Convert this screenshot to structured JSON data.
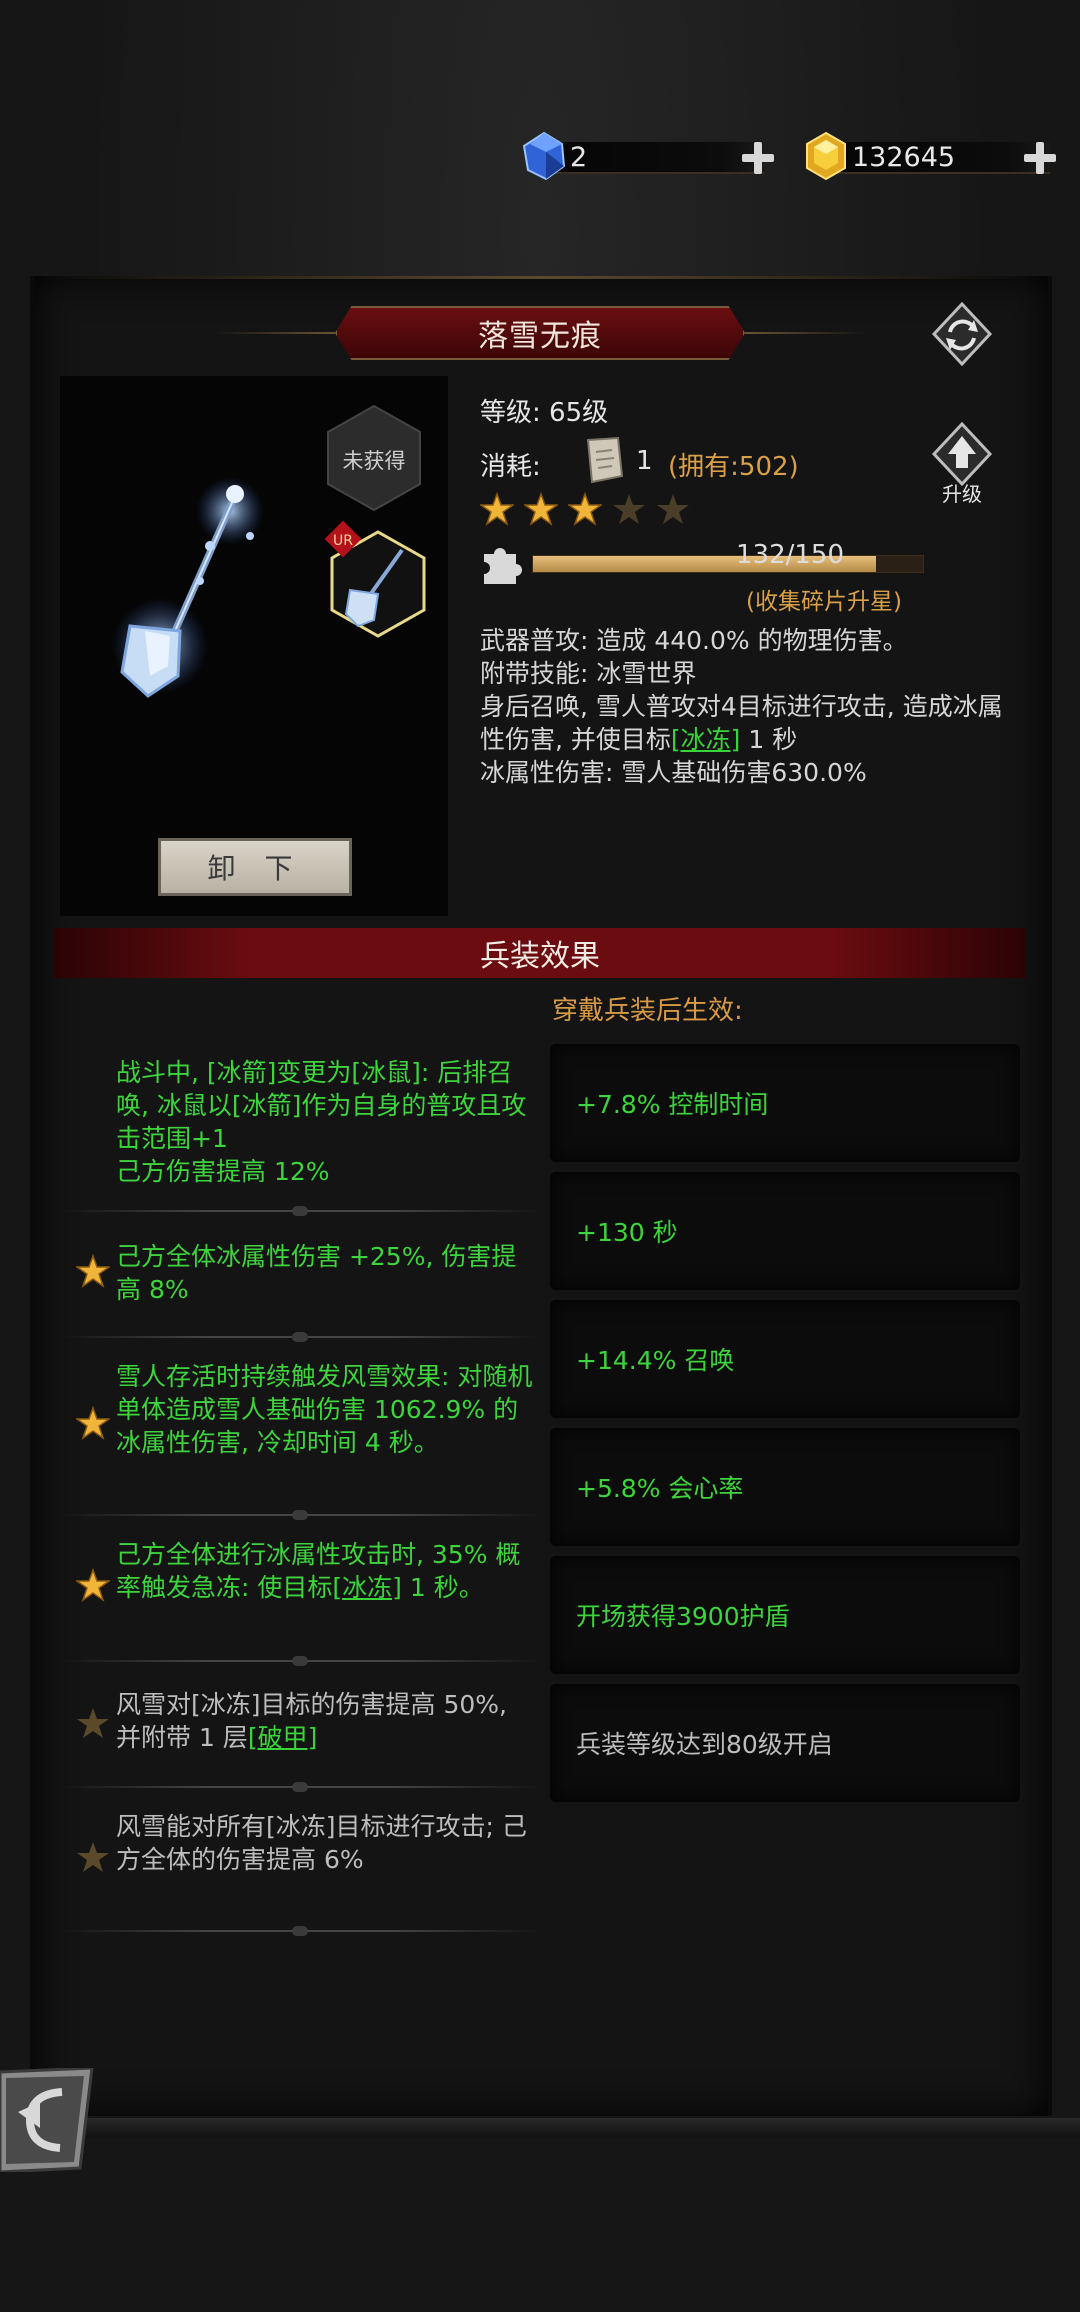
{
  "currency": {
    "gems": {
      "icon": "blue-crystal-icon",
      "value": "2"
    },
    "coins": {
      "icon": "gold-crystal-icon",
      "value": "132645"
    }
  },
  "title": "落雪无痕",
  "weapon": {
    "status": "未获得",
    "rarity_badge": "UR",
    "unequip_label": "卸 下"
  },
  "info": {
    "level_label": "等级:",
    "level_value": "65级",
    "cost_label": "消耗:",
    "cost_amount": "1",
    "owned": "(拥有:502)",
    "upgrade_label": "升级",
    "stars_filled": 3,
    "stars_total": 5,
    "shards_text": "132/150",
    "shards_current": 132,
    "shards_max": 150,
    "shards_hint": "(收集碎片升星)",
    "desc_line1": "武器普攻: 造成 440.0% 的物理伤害。",
    "desc_line2": "附带技能: 冰雪世界",
    "desc_line3a": "身后召唤, 雪人普攻对4目标进行攻击, 造成冰属性伤害, 并使目标",
    "desc_link": "[冰冻]",
    "desc_line3b": " 1 秒",
    "desc_line4": "冰属性伤害: 雪人基础伤害630.0%"
  },
  "section": {
    "header": "兵装效果",
    "subheader": "穿戴兵装后生效:"
  },
  "effects": [
    {
      "text": "战斗中, [冰箭]变更为[冰鼠]: 后排召唤, 冰鼠以[冰箭]作为自身的普攻且攻击范围+1\n己方伤害提高 12%",
      "star": "none"
    },
    {
      "text": "己方全体冰属性伤害 +25%, 伤害提高 8%",
      "star": "gold"
    },
    {
      "text": "雪人存活时持续触发风雪效果: 对随机单体造成雪人基础伤害 1062.9% 的冰属性伤害, 冷却时间 4 秒。",
      "star": "gold"
    },
    {
      "text_a": "己方全体进行冰属性攻击时, 35% 概率触发急冻: 使目标[",
      "link": "冰冻]",
      "text_b": " 1 秒。",
      "star": "gold"
    },
    {
      "text_a": "风雪对[冰冻]目标的伤害提高 50%, 并附带 1 层",
      "link": "[破甲]",
      "star": "dim"
    },
    {
      "text": "风雪能对所有[冰冻]目标进行攻击; 己方全体的伤害提高 6%",
      "star": "dim"
    }
  ],
  "stats": [
    {
      "text": "+7.8% 控制时间",
      "active": true
    },
    {
      "text": "+130 秒",
      "active": true
    },
    {
      "text": "+14.4% 召唤",
      "active": true
    },
    {
      "text": "+5.8% 会心率",
      "active": true
    },
    {
      "text": "开场获得3900护盾",
      "active": true
    },
    {
      "text": "兵装等级达到80级开启",
      "active": false
    }
  ],
  "colors": {
    "accent_red": "#6a0c10",
    "active_green": "#3ed43d",
    "gold": "#d9a049"
  }
}
